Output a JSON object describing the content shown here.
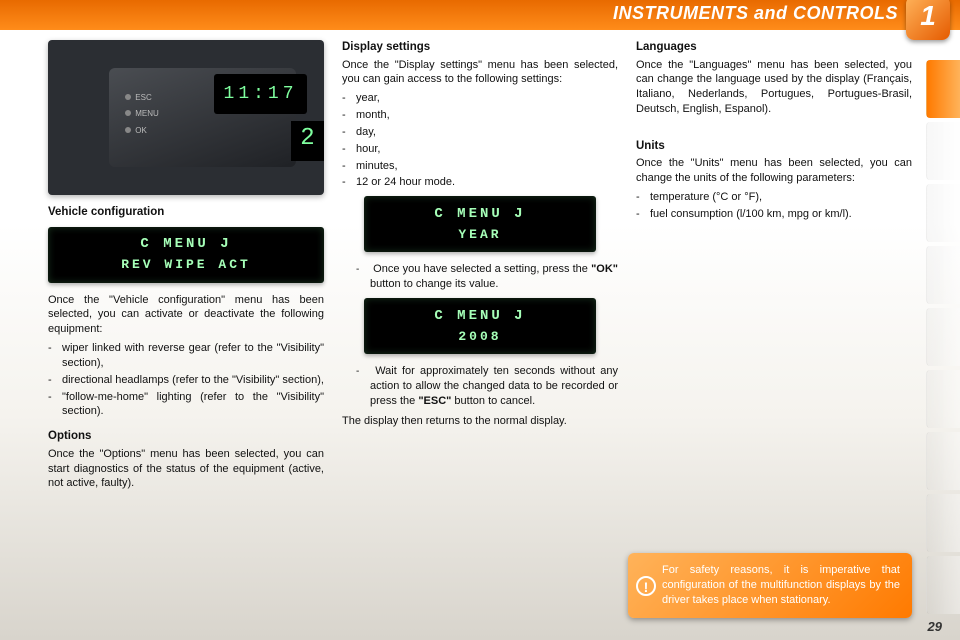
{
  "header": {
    "title": "INSTRUMENTS and CONTROLS",
    "badge": "1"
  },
  "page_number": "29",
  "photo": {
    "time": "11:17",
    "edge": "2",
    "buttons": [
      "ESC",
      "MENU",
      "OK"
    ]
  },
  "col1": {
    "vehicle_config_heading": "Vehicle configuration",
    "lcd1_line1": "C    MENU    J",
    "lcd1_line2": "REV WIPE ACT",
    "vc_intro": "Once the \"Vehicle configuration\" menu has been selected, you can activate or deactivate the following equipment:",
    "vc_items": [
      "wiper linked with reverse gear (refer to the \"Visibility\" section),",
      "directional headlamps (refer to the \"Visibility\" section),",
      "\"follow-me-home\" lighting (refer to the \"Visibility\" section)."
    ],
    "options_heading": "Options",
    "options_body": "Once the \"Options\" menu has been selected, you can start diagnostics of the status of the equipment (active, not active, faulty)."
  },
  "col2": {
    "ds_heading": "Display settings",
    "ds_intro": "Once the \"Display settings\" menu has been selected, you can gain access to the following settings:",
    "ds_items": [
      "year,",
      "month,",
      "day,",
      "hour,",
      "minutes,",
      "12 or 24 hour mode."
    ],
    "lcd2_line1": "C    MENU    J",
    "lcd2_line2": "YEAR",
    "step1_pre": "Once you have selected a setting, press the ",
    "step1_bold": "\"OK\"",
    "step1_post": " button to change its value.",
    "lcd3_line1": "C    MENU    J",
    "lcd3_line2": "2008",
    "step2_pre": "Wait for approximately ten seconds without any action to allow the changed data to be recorded or press the ",
    "step2_bold": "\"ESC\"",
    "step2_post": " button to cancel.",
    "outro": "The display then returns to the normal display."
  },
  "col3": {
    "lang_heading": "Languages",
    "lang_body": "Once the \"Languages\" menu has been selected, you can change the language used by the display (Français, Italiano, Nederlands, Portugues, Portugues-Brasil, Deutsch, English, Espanol).",
    "units_heading": "Units",
    "units_intro": "Once the \"Units\" menu has been selected, you can change the units of the following parameters:",
    "units_items": [
      "temperature (°C or °F),",
      "fuel consumption (l/100 km, mpg or km/l)."
    ]
  },
  "warning": "For safety reasons, it is imperative that configuration of the multifunction displays by the driver takes place when stationary."
}
